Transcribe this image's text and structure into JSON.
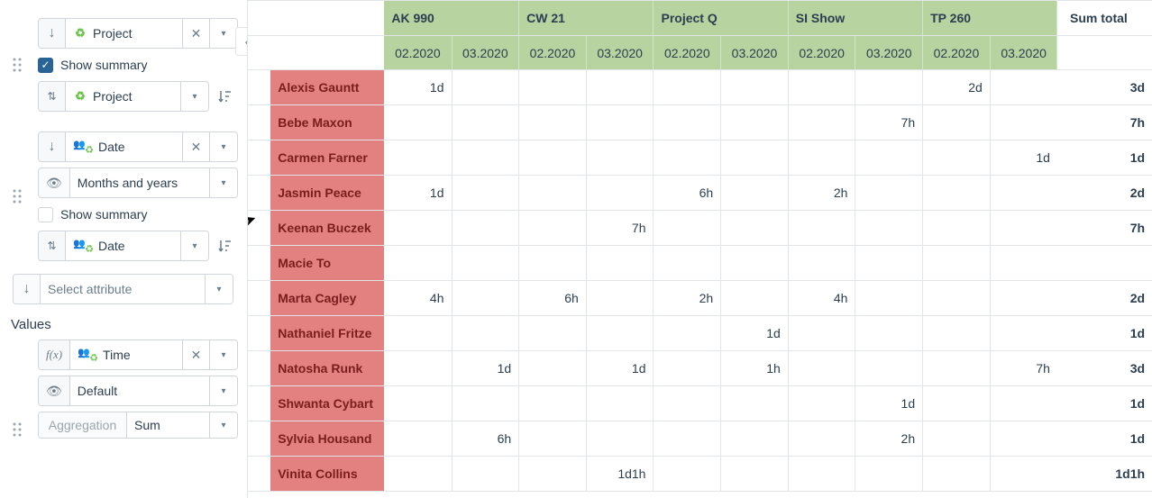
{
  "sidebar": {
    "group1": {
      "field": "Project",
      "show_summary_label": "Show summary",
      "show_summary_checked": true,
      "sort_field": "Project"
    },
    "group2": {
      "field": "Date",
      "granularity": "Months and years",
      "show_summary_label": "Show summary",
      "show_summary_checked": false,
      "sort_field": "Date"
    },
    "attribute_placeholder": "Select attribute",
    "values_label": "Values",
    "value_block": {
      "field": "Time",
      "format": "Default",
      "aggregation_label": "Aggregation",
      "aggregation_value": "Sum"
    }
  },
  "pivot": {
    "sum_total_label": "Sum total",
    "column_groups": [
      {
        "label": "AK 990",
        "subs": [
          "02.2020",
          "03.2020"
        ]
      },
      {
        "label": "CW 21",
        "subs": [
          "02.2020",
          "03.2020"
        ]
      },
      {
        "label": "Project Q",
        "subs": [
          "02.2020",
          "03.2020"
        ]
      },
      {
        "label": "SI Show",
        "subs": [
          "02.2020",
          "03.2020"
        ]
      },
      {
        "label": "TP 260",
        "subs": [
          "02.2020",
          "03.2020"
        ]
      }
    ],
    "rows": [
      {
        "name": "Alexis Gauntt",
        "cells": [
          "1d",
          "",
          "",
          "",
          "",
          "",
          "",
          "",
          "2d",
          ""
        ],
        "sum": "3d"
      },
      {
        "name": "Bebe Maxon",
        "cells": [
          "",
          "",
          "",
          "",
          "",
          "",
          "",
          "7h",
          "",
          ""
        ],
        "sum": "7h"
      },
      {
        "name": "Carmen Farner",
        "cells": [
          "",
          "",
          "",
          "",
          "",
          "",
          "",
          "",
          "",
          "1d"
        ],
        "sum": "1d"
      },
      {
        "name": "Jasmin Peace",
        "cells": [
          "1d",
          "",
          "",
          "",
          "6h",
          "",
          "2h",
          "",
          "",
          ""
        ],
        "sum": "2d"
      },
      {
        "name": "Keenan Buczek",
        "cells": [
          "",
          "",
          "",
          "7h",
          "",
          "",
          "",
          "",
          "",
          ""
        ],
        "sum": "7h"
      },
      {
        "name": "Macie To",
        "cells": [
          "",
          "",
          "",
          "",
          "",
          "",
          "",
          "",
          "",
          ""
        ],
        "sum": ""
      },
      {
        "name": "Marta Cagley",
        "cells": [
          "4h",
          "",
          "6h",
          "",
          "2h",
          "",
          "4h",
          "",
          "",
          ""
        ],
        "sum": "2d"
      },
      {
        "name": "Nathaniel Fritze",
        "cells": [
          "",
          "",
          "",
          "",
          "",
          "1d",
          "",
          "",
          "",
          ""
        ],
        "sum": "1d"
      },
      {
        "name": "Natosha Runk",
        "cells": [
          "",
          "1d",
          "",
          "1d",
          "",
          "1h",
          "",
          "",
          "",
          "7h"
        ],
        "sum": "3d"
      },
      {
        "name": "Shwanta Cybart",
        "cells": [
          "",
          "",
          "",
          "",
          "",
          "",
          "",
          "1d",
          "",
          ""
        ],
        "sum": "1d"
      },
      {
        "name": "Sylvia Housand",
        "cells": [
          "",
          "6h",
          "",
          "",
          "",
          "",
          "",
          "2h",
          "",
          ""
        ],
        "sum": "1d"
      },
      {
        "name": "Vinita Collins",
        "cells": [
          "",
          "",
          "",
          "1d1h",
          "",
          "",
          "",
          "",
          "",
          ""
        ],
        "sum": "1d1h"
      }
    ]
  },
  "chart_data": {
    "type": "table",
    "note": "Pivot table of time values (days d / hours h) per person x project x month. Blank = no value.",
    "row_dim": "Person",
    "col_dim_1": "Project",
    "col_dim_2": "Month",
    "rows": [
      "Alexis Gauntt",
      "Bebe Maxon",
      "Carmen Farner",
      "Jasmin Peace",
      "Keenan Buczek",
      "Macie To",
      "Marta Cagley",
      "Nathaniel Fritze",
      "Natosha Runk",
      "Shwanta Cybart",
      "Sylvia Housand",
      "Vinita Collins"
    ],
    "columns": [
      [
        "AK 990",
        "02.2020"
      ],
      [
        "AK 990",
        "03.2020"
      ],
      [
        "CW 21",
        "02.2020"
      ],
      [
        "CW 21",
        "03.2020"
      ],
      [
        "Project Q",
        "02.2020"
      ],
      [
        "Project Q",
        "03.2020"
      ],
      [
        "SI Show",
        "02.2020"
      ],
      [
        "SI Show",
        "03.2020"
      ],
      [
        "TP 260",
        "02.2020"
      ],
      [
        "TP 260",
        "03.2020"
      ]
    ],
    "values": [
      [
        "1d",
        null,
        null,
        null,
        null,
        null,
        null,
        null,
        "2d",
        null
      ],
      [
        null,
        null,
        null,
        null,
        null,
        null,
        null,
        "7h",
        null,
        null
      ],
      [
        null,
        null,
        null,
        null,
        null,
        null,
        null,
        null,
        null,
        "1d"
      ],
      [
        "1d",
        null,
        null,
        null,
        "6h",
        null,
        "2h",
        null,
        null,
        null
      ],
      [
        null,
        null,
        null,
        "7h",
        null,
        null,
        null,
        null,
        null,
        null
      ],
      [
        null,
        null,
        null,
        null,
        null,
        null,
        null,
        null,
        null,
        null
      ],
      [
        "4h",
        null,
        "6h",
        null,
        "2h",
        null,
        "4h",
        null,
        null,
        null
      ],
      [
        null,
        null,
        null,
        null,
        null,
        "1d",
        null,
        null,
        null,
        null
      ],
      [
        null,
        "1d",
        null,
        "1d",
        null,
        "1h",
        null,
        null,
        null,
        "7h"
      ],
      [
        null,
        null,
        null,
        null,
        null,
        null,
        null,
        "1d",
        null,
        null
      ],
      [
        null,
        "6h",
        null,
        null,
        null,
        null,
        null,
        "2h",
        null,
        null
      ],
      [
        null,
        null,
        null,
        "1d1h",
        null,
        null,
        null,
        null,
        null,
        null
      ]
    ],
    "row_totals": [
      "3d",
      "7h",
      "1d",
      "2d",
      "7h",
      null,
      "2d",
      "1d",
      "3d",
      "1d",
      "1d",
      "1d1h"
    ]
  }
}
